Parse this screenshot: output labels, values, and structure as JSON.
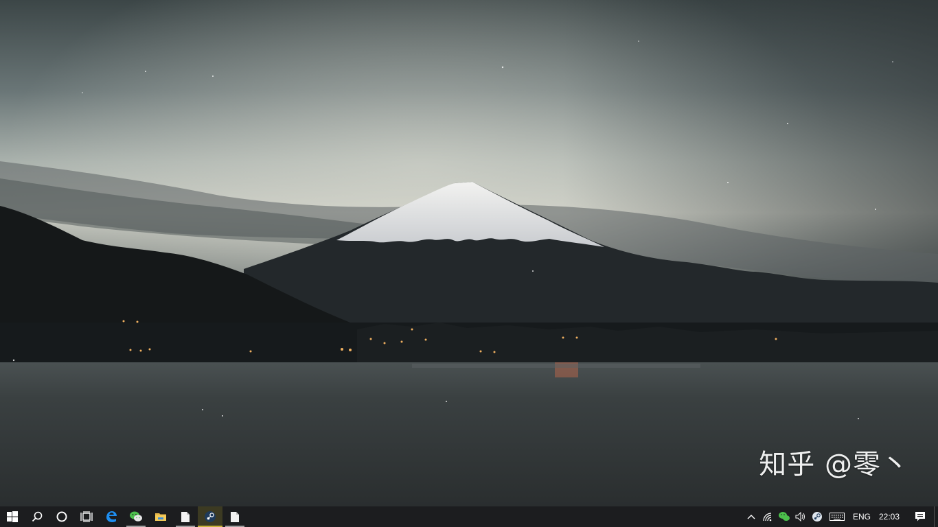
{
  "desktop": {
    "wallpaper": "Mount Fuji at dusk over a lake",
    "watermark": "知乎 @零丶"
  },
  "taskbar": {
    "background": "#1c1d1f",
    "pinned": [
      {
        "name": "start",
        "icon": "windows-logo-icon"
      },
      {
        "name": "search",
        "icon": "search-icon"
      },
      {
        "name": "cortana",
        "icon": "cortana-circle-icon"
      },
      {
        "name": "task-view",
        "icon": "task-view-icon"
      },
      {
        "name": "edge",
        "icon": "edge-icon"
      },
      {
        "name": "wechat",
        "icon": "wechat-icon",
        "running": true
      },
      {
        "name": "file-explorer",
        "icon": "folder-icon"
      },
      {
        "name": "document",
        "icon": "document-icon",
        "running": true
      },
      {
        "name": "steam",
        "icon": "steam-icon",
        "running": true,
        "active": true
      },
      {
        "name": "document-2",
        "icon": "document-icon",
        "running": true
      }
    ],
    "tray": {
      "language": "ENG",
      "time": "22:03",
      "icons": [
        "chevron-up-icon",
        "wifi-icon",
        "wechat-tray-icon",
        "volume-icon",
        "steam-tray-icon",
        "keyboard-icon"
      ]
    }
  }
}
